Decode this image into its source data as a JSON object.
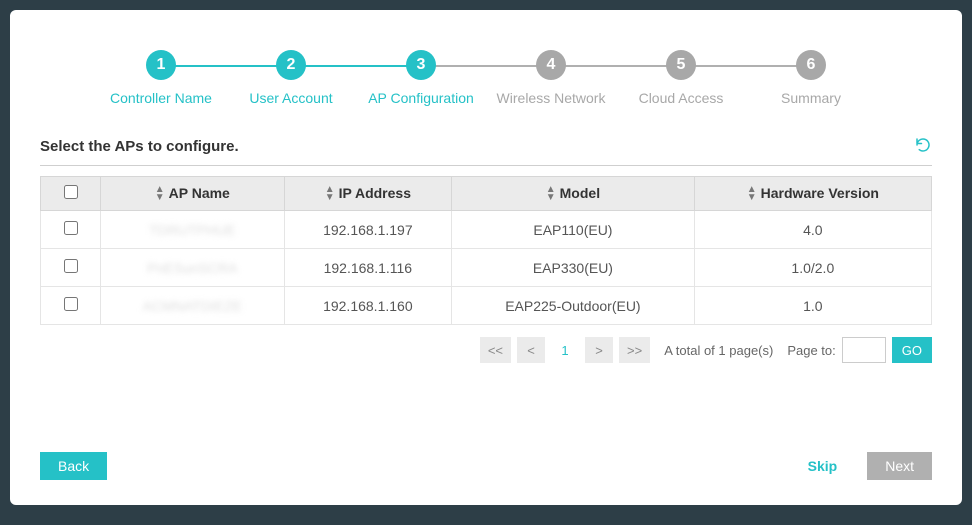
{
  "steps": [
    {
      "num": "1",
      "label": "Controller Name",
      "state": "active",
      "line": "done"
    },
    {
      "num": "2",
      "label": "User Account",
      "state": "active",
      "line": "done"
    },
    {
      "num": "3",
      "label": "AP Configuration",
      "state": "active",
      "line": "todo"
    },
    {
      "num": "4",
      "label": "Wireless Network",
      "state": "inactive",
      "line": "todo"
    },
    {
      "num": "5",
      "label": "Cloud Access",
      "state": "inactive",
      "line": "todo"
    },
    {
      "num": "6",
      "label": "Summary",
      "state": "inactive",
      "line": "none"
    }
  ],
  "section_title": "Select the APs to configure.",
  "columns": {
    "ap_name": "AP Name",
    "ip": "IP Address",
    "model": "Model",
    "hw": "Hardware Version"
  },
  "rows": [
    {
      "name": "TDRUTPHUE",
      "ip": "192.168.1.197",
      "model": "EAP110(EU)",
      "hw": "4.0"
    },
    {
      "name": "PnESunSCRA",
      "ip": "192.168.1.116",
      "model": "EAP330(EU)",
      "hw": "1.0/2.0"
    },
    {
      "name": "ACMNATDIEZE",
      "ip": "192.168.1.160",
      "model": "EAP225-Outdoor(EU)",
      "hw": "1.0"
    }
  ],
  "pagination": {
    "first": "<<",
    "prev": "<",
    "current": "1",
    "next": ">",
    "last": ">>",
    "total_text": "A total of 1 page(s)",
    "page_to_label": "Page to:",
    "go": "GO"
  },
  "buttons": {
    "back": "Back",
    "skip": "Skip",
    "next": "Next"
  }
}
